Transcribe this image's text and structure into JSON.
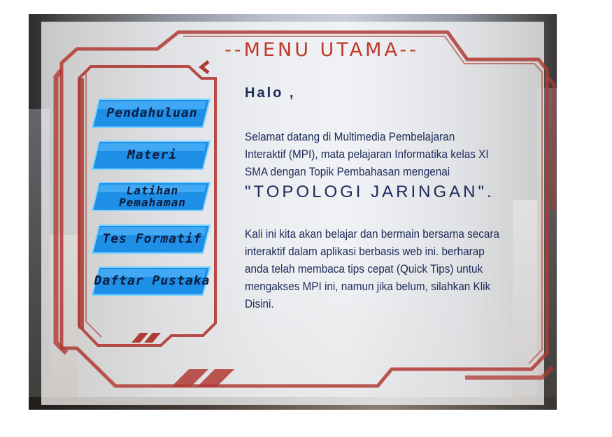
{
  "header": {
    "title": "--MENU UTAMA--"
  },
  "menu": {
    "items": [
      {
        "label": "Pendahuluan"
      },
      {
        "label": "Materi"
      },
      {
        "label": "Latihan Pemahaman"
      },
      {
        "label": "Tes Formatif"
      },
      {
        "label": "Daftar Pustaka"
      }
    ]
  },
  "content": {
    "greeting": "Halo ,",
    "intro": "Selamat datang di Multimedia Pembelajaran Interaktif (MPI), mata pelajaran Informatika kelas XI SMA dengan Topik Pembahasan mengenai",
    "topic": "\"TOPOLOGI JARINGAN\".",
    "body": "Kali ini kita akan belajar dan bermain bersama secara interaktif dalam aplikasi berbasis web ini. berharap anda telah membaca tips cepat (Quick Tips) untuk mengakses MPI ini, namun jika belum, silahkan Klik Disini."
  },
  "colors": {
    "frame_red": "#b03a34",
    "button_blue": "#1e8fe6",
    "text_navy": "#1c2a5a",
    "title_red": "#c0392b"
  }
}
